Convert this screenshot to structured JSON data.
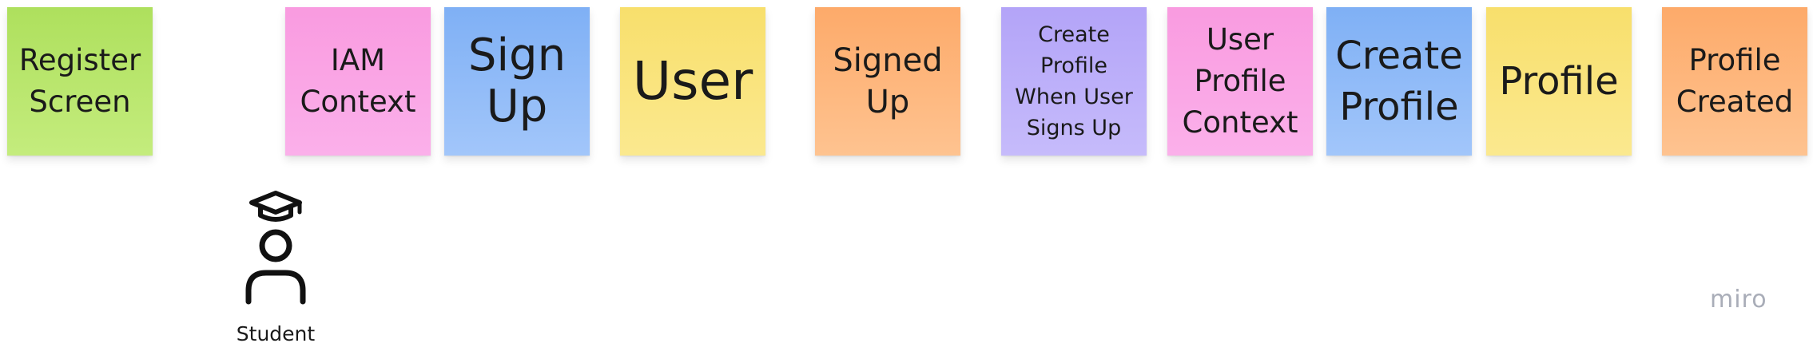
{
  "board": {
    "stickies": [
      {
        "id": "register-screen",
        "text": "Register\nScreen",
        "color": "#bce86f"
      },
      {
        "id": "iam-context",
        "text": "IAM\nContext",
        "color": "#faa5e6"
      },
      {
        "id": "sign-up",
        "text": "Sign\nUp",
        "color": "#92bdf8"
      },
      {
        "id": "user",
        "text": "User",
        "color": "#fae37c"
      },
      {
        "id": "signed-up",
        "text": "Signed\nUp",
        "color": "#feb67d"
      },
      {
        "id": "create-profile-policy",
        "text": "Create\nProfile\nWhen User\nSigns Up",
        "color": "#bdb0fa"
      },
      {
        "id": "user-profile-context",
        "text": "User\nProfile\nContext",
        "color": "#faa5e6"
      },
      {
        "id": "create-profile",
        "text": "Create\nProfile",
        "color": "#92bdf8"
      },
      {
        "id": "profile",
        "text": "Profile",
        "color": "#fae37c"
      },
      {
        "id": "profile-created",
        "text": "Profile\nCreated",
        "color": "#feb67d"
      }
    ],
    "actor": {
      "label": "Student",
      "icon": "student-graduation-cap-icon"
    },
    "brand": "miro"
  }
}
